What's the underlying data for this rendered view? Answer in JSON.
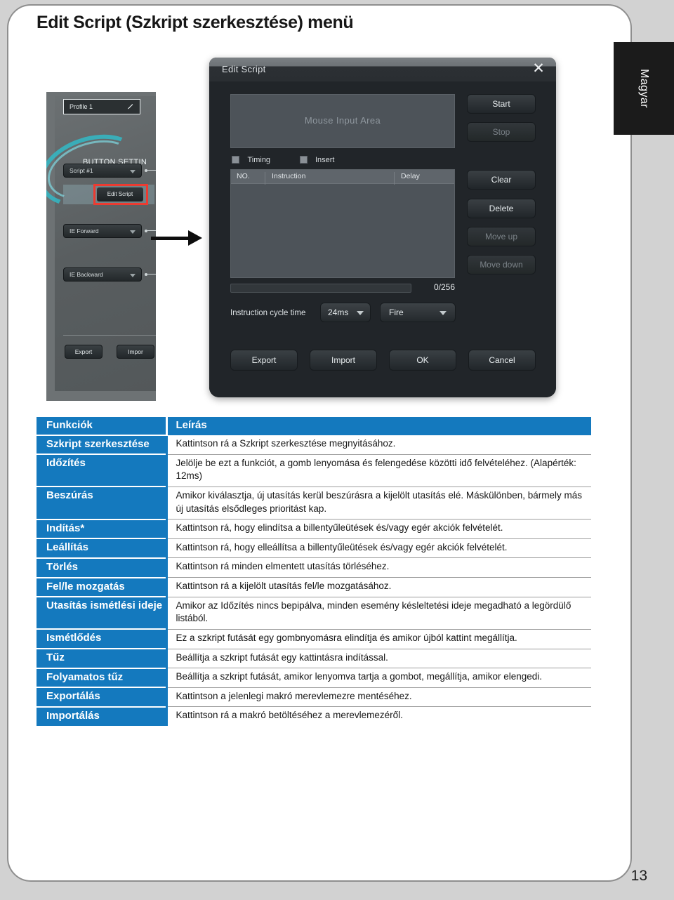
{
  "page": {
    "title": "Edit Script (Szkript szerkesztése) menü",
    "language_tab": "Magyar",
    "page_number": "13"
  },
  "app_panel": {
    "profile_label": "Profile 1",
    "section_label": "BUTTON SETTIN",
    "dropdowns": [
      {
        "label": "Script #1"
      },
      {
        "label": "IE Forward"
      },
      {
        "label": "IE Backward"
      }
    ],
    "edit_script_button": "Edit Script",
    "export_button": "Export",
    "import_button": "Impor"
  },
  "dialog": {
    "title": "Edit Script",
    "close_label": "✕",
    "mouse_input_area": "Mouse Input Area",
    "checkboxes": [
      {
        "label": "Timing",
        "checked": false
      },
      {
        "label": "Insert",
        "checked": false
      }
    ],
    "list_headers": {
      "no": "NO.",
      "instruction": "Instruction",
      "delay": "Delay"
    },
    "capacity_label": "0/256",
    "cycle_time_label": "Instruction cycle time",
    "cycle_time_value": "24ms",
    "mode_value": "Fire",
    "side_buttons": [
      {
        "label": "Start",
        "disabled": false
      },
      {
        "label": "Stop",
        "disabled": true
      },
      {
        "label": "Clear",
        "disabled": false
      },
      {
        "label": "Delete",
        "disabled": false
      },
      {
        "label": "Move up",
        "disabled": true
      },
      {
        "label": "Move down",
        "disabled": true
      }
    ],
    "footer_buttons": [
      {
        "label": "Export",
        "disabled": false
      },
      {
        "label": "Import",
        "disabled": false
      },
      {
        "label": "OK",
        "disabled": false
      },
      {
        "label": "Cancel",
        "disabled": false
      }
    ]
  },
  "table": {
    "headers": {
      "function": "Funkciók",
      "description": "Leírás"
    },
    "rows": [
      {
        "function": "Szkript szerkesztése",
        "description": "Kattintson rá a Szkript szerkesztése megnyitásához."
      },
      {
        "function": "Időzítés",
        "description": "Jelölje be ezt a funkciót, a gomb lenyomása és felengedése közötti idő felvételéhez. (Alapérték: 12ms)"
      },
      {
        "function": "Beszúrás",
        "description": "Amikor kiválasztja, új utasítás kerül beszúrásra a kijelölt utasítás elé. Máskülönben, bármely más új utasítás elsődleges prioritást kap."
      },
      {
        "function": "Indítás*",
        "description": "Kattintson rá, hogy elindítsa a billentyűleütések és/vagy egér akciók felvételét."
      },
      {
        "function": "Leállítás",
        "description": "Kattintson rá, hogy elleállítsa a billentyűleütések és/vagy egér akciók felvételét."
      },
      {
        "function": "Törlés",
        "description": "Kattintson rá minden elmentett utasítás törléséhez."
      },
      {
        "function": "Fel/le mozgatás",
        "description": "Kattintson rá a kijelölt utasítás fel/le mozgatásához."
      },
      {
        "function": "Utasítás ismétlési ideje",
        "description": "Amikor az Időzítés nincs bepipálva, minden esemény késleltetési ideje megadható a legördülő listából."
      },
      {
        "function": "Ismétlődés",
        "description": "Ez a szkript futását egy gombnyomásra elindítja és amikor újból kattint megállítja."
      },
      {
        "function": "Tűz",
        "description": "Beállítja a szkript futását egy kattintásra indítással."
      },
      {
        "function": "Folyamatos tűz",
        "description": "Beállítja a szkript futását, amikor lenyomva tartja a gombot, megállítja, amikor elengedi."
      },
      {
        "function": "Exportálás",
        "description": "Kattintson a jelenlegi makró merevlemezre mentéséhez."
      },
      {
        "function": "Importálás",
        "description": "Kattintson rá a makró betöltéséhez a merevlemezéről."
      }
    ]
  },
  "colors": {
    "accent_blue": "#1479be",
    "page_bg": "#d2d2d2",
    "sheet_bg": "#ffffff",
    "tab_bg": "#1b1b1b",
    "highlight_red": "#ec3b31",
    "dialog_bg": "#212529"
  }
}
